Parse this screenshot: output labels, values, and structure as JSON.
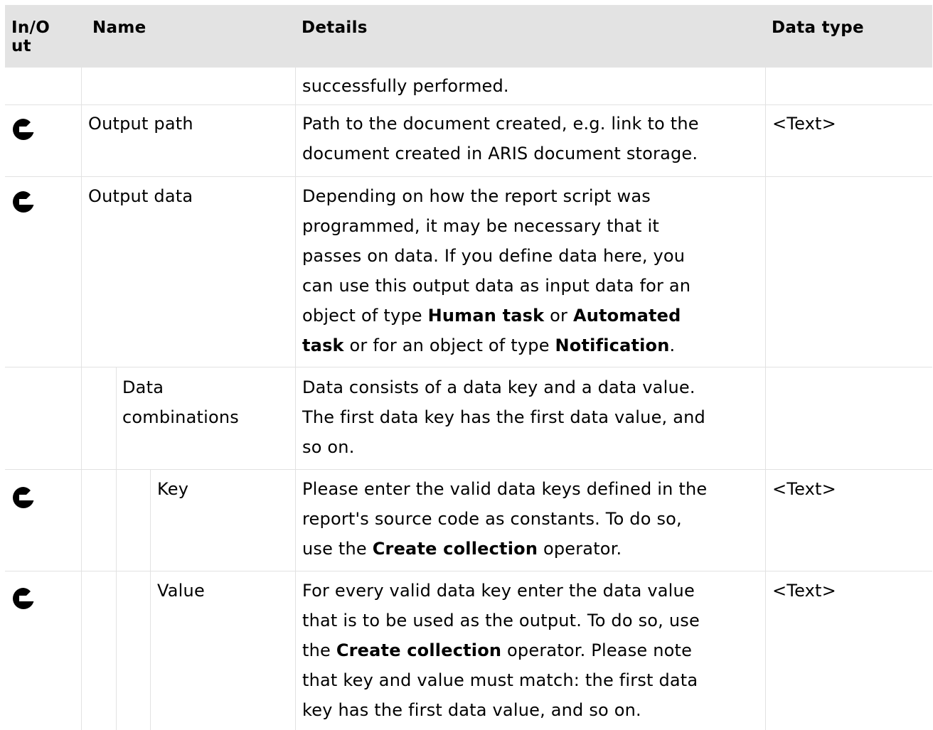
{
  "header": {
    "in_out_line1": "In/O",
    "in_out_line2": "ut",
    "name": "Name",
    "details": "Details",
    "data_type": "Data type"
  },
  "rows": [
    {
      "details_lines": [
        "successfully performed."
      ]
    },
    {
      "io_icon": "output-arrow-icon",
      "name": "Output path",
      "details_lines": [
        "Path to the document created, e.g. link to the",
        "document created in ARIS document storage."
      ],
      "data_type": "<Text>"
    },
    {
      "io_icon": "output-arrow-icon",
      "name": "Output data",
      "details_lines": [
        "Depending on how the report script was",
        "programmed, it may be necessary that it",
        "passes on data. If you define data here, you",
        "can use this output data as input data for an"
      ],
      "details_rich_line5": {
        "pre": "object of type ",
        "b1": "Human task",
        "mid": " or ",
        "b2": "Automated"
      },
      "details_rich_line6": {
        "b1": "task",
        "mid": " or for an object of type ",
        "b2": "Notification",
        "post": "."
      }
    },
    {
      "name_line1": "Data",
      "name_line2": "combinations",
      "details_lines": [
        "Data consists of a data key and a data value.",
        "The first data key has the first data value, and",
        "so on."
      ]
    },
    {
      "io_icon": "output-arrow-icon",
      "name": "Key",
      "details_lines": [
        "Please enter the valid data keys defined in the",
        "report's source code as constants. To do so,"
      ],
      "details_rich_line3": {
        "pre": "use the ",
        "b1": "Create collection",
        "post": " operator."
      },
      "data_type": "<Text>"
    },
    {
      "io_icon": "output-arrow-icon",
      "name": "Value",
      "details_lines": [
        "For every valid data key enter the data value",
        "that is to be used as the output. To do so, use"
      ],
      "details_rich_line3": {
        "pre": "the ",
        "b1": "Create collection",
        "post": " operator. Please note"
      },
      "details_lines_after": [
        "that key and value must match: the first data",
        "key has the first data value, and so on."
      ],
      "data_type": "<Text>"
    }
  ]
}
